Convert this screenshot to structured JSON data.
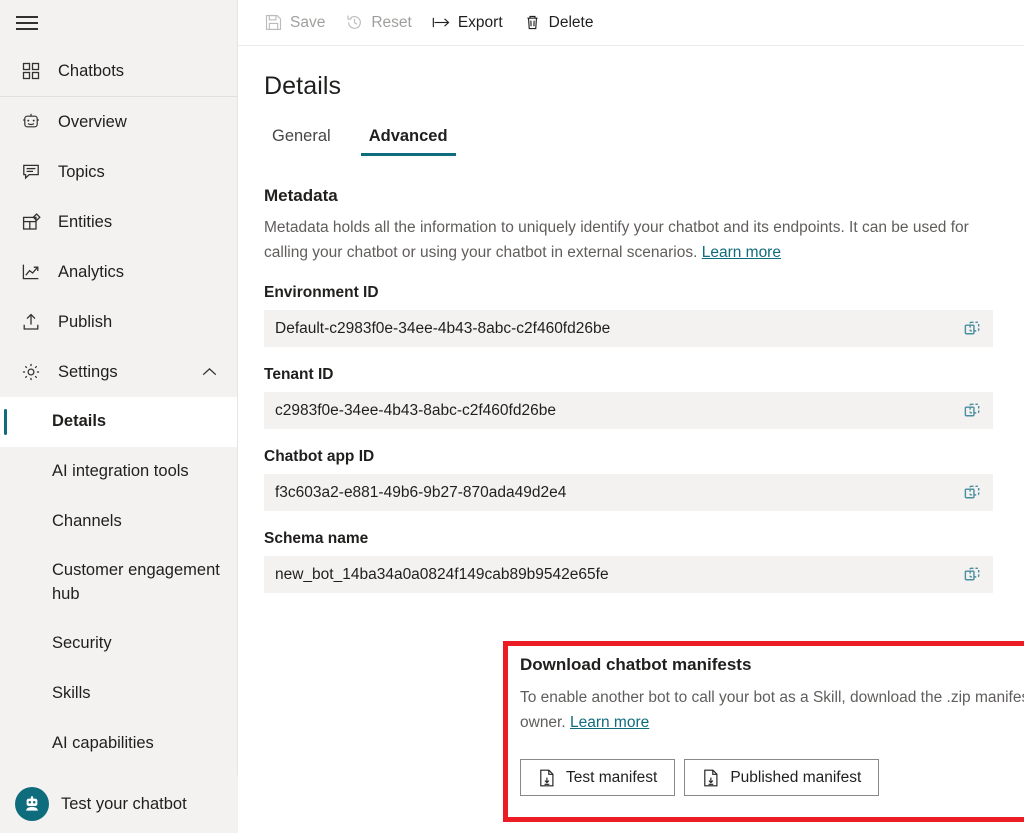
{
  "sidebar": {
    "menu_icon": "hamburger-icon",
    "top_items": [
      {
        "label": "Chatbots",
        "icon": "grid-icon"
      }
    ],
    "items": [
      {
        "label": "Overview",
        "icon": "robot-icon"
      },
      {
        "label": "Topics",
        "icon": "chat-icon"
      },
      {
        "label": "Entities",
        "icon": "entities-icon"
      },
      {
        "label": "Analytics",
        "icon": "analytics-icon"
      },
      {
        "label": "Publish",
        "icon": "publish-icon"
      }
    ],
    "settings": {
      "label": "Settings",
      "icon": "gear-icon",
      "chevron": "chevron-up-icon",
      "expanded": true
    },
    "sub_items": [
      {
        "label": "Details",
        "selected": true
      },
      {
        "label": "AI integration tools",
        "selected": false
      },
      {
        "label": "Channels",
        "selected": false
      },
      {
        "label": "Customer engagement hub",
        "selected": false
      },
      {
        "label": "Security",
        "selected": false
      },
      {
        "label": "Skills",
        "selected": false
      },
      {
        "label": "AI capabilities",
        "selected": false
      }
    ],
    "test_chatbot": {
      "label": "Test your chatbot",
      "icon": "bot-avatar-icon"
    }
  },
  "toolbar": {
    "save": {
      "label": "Save",
      "icon": "save-icon",
      "disabled": true
    },
    "reset": {
      "label": "Reset",
      "icon": "reset-icon",
      "disabled": true
    },
    "export": {
      "label": "Export",
      "icon": "export-icon",
      "disabled": false
    },
    "delete": {
      "label": "Delete",
      "icon": "trash-icon",
      "disabled": false
    }
  },
  "page": {
    "title": "Details",
    "tabs": [
      {
        "label": "General",
        "active": false
      },
      {
        "label": "Advanced",
        "active": true
      }
    ]
  },
  "metadata": {
    "heading": "Metadata",
    "description": "Metadata holds all the information to uniquely identify your chatbot and its endpoints. It can be used for calling your chatbot or using your chatbot in external scenarios.",
    "learn_more": "Learn more",
    "fields": [
      {
        "label": "Environment ID",
        "value": "Default-c2983f0e-34ee-4b43-8abc-c2f460fd26be",
        "copy_icon": "copy-icon"
      },
      {
        "label": "Tenant ID",
        "value": "c2983f0e-34ee-4b43-8abc-c2f460fd26be",
        "copy_icon": "copy-icon"
      },
      {
        "label": "Chatbot app ID",
        "value": "f3c603a2-e881-49b6-9b27-870ada49d2e4",
        "copy_icon": "copy-icon"
      },
      {
        "label": "Schema name",
        "value": "new_bot_14ba34a0a0824f149cab89b9542e65fe",
        "copy_icon": "copy-icon"
      }
    ]
  },
  "download": {
    "heading": "Download chatbot manifests",
    "description": "To enable another bot to call your bot as a Skill, download the .zip manifest, and give it to the other bot's owner.",
    "learn_more": "Learn more",
    "buttons": [
      {
        "label": "Test manifest",
        "icon": "download-file-icon"
      },
      {
        "label": "Published manifest",
        "icon": "download-file-icon"
      }
    ],
    "highlight_color": "#ec1c24"
  },
  "colors": {
    "accent": "#0f6c7d",
    "sidebar_bg": "#f3f2f1",
    "field_bg": "#f3f2f1",
    "text": "#201f1e",
    "muted_text": "#605e5c",
    "disabled_text": "#a19f9d",
    "highlight": "#ec1c24"
  }
}
